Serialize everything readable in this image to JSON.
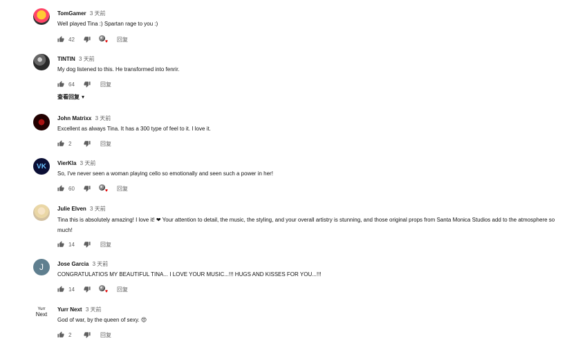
{
  "comments": [
    {
      "author": "TomGamer",
      "time": "3 天前",
      "text": "Well played Tina :) Spartan rage to you :)",
      "likes": "42",
      "reply_label": "回复",
      "creator_heart": true
    },
    {
      "author": "TINTIN",
      "time": "3 天前",
      "text": "My dog listened to this. He transformed into fenrir.",
      "likes": "64",
      "reply_label": "回复",
      "creator_heart": false,
      "view_replies": "查看回复"
    },
    {
      "author": "John Matrixx",
      "time": "3 天前",
      "text": "Excellent as always Tina. It has a 300 type of feel to it. I love it.",
      "likes": "2",
      "reply_label": "回复",
      "creator_heart": false
    },
    {
      "author": "VierKla",
      "avatar_text": "VK",
      "time": "3 天前",
      "text": "So, I've never seen a woman playing cello so emotionally and seen such a power in her!",
      "likes": "60",
      "reply_label": "回复",
      "creator_heart": true
    },
    {
      "author": "Julie Elven",
      "time": "3 天前",
      "text": "Tina this is absolutely amazing! I love it! ❤ Your attention to detail, the music, the styling, and your overall artistry is stunning, and those original props from Santa Monica Studios add to the atmosphere so much!",
      "likes": "14",
      "reply_label": "回复",
      "creator_heart": false
    },
    {
      "author": "Jose Garcia",
      "avatar_text": "J",
      "time": "3 天前",
      "text": "CONGRATULATIOS MY BEAUTIFUL TINA... I LOVE YOUR MUSIC...!!! HUGS AND KISSES FOR YOU...!!!",
      "likes": "14",
      "reply_label": "回复",
      "creator_heart": true
    },
    {
      "author": "Yurr Next",
      "avatar_text_top": "Yurr",
      "avatar_text_bottom": "Next",
      "time": "3 天前",
      "text": "God of war, by the queen of sexy. 😍",
      "likes": "2",
      "reply_label": "回复",
      "creator_heart": false
    }
  ],
  "icons": {
    "like": "thumbs-up-icon",
    "dislike": "thumbs-down-icon",
    "heart": "creator-heart-icon",
    "chevron": "chevron-down-icon"
  }
}
